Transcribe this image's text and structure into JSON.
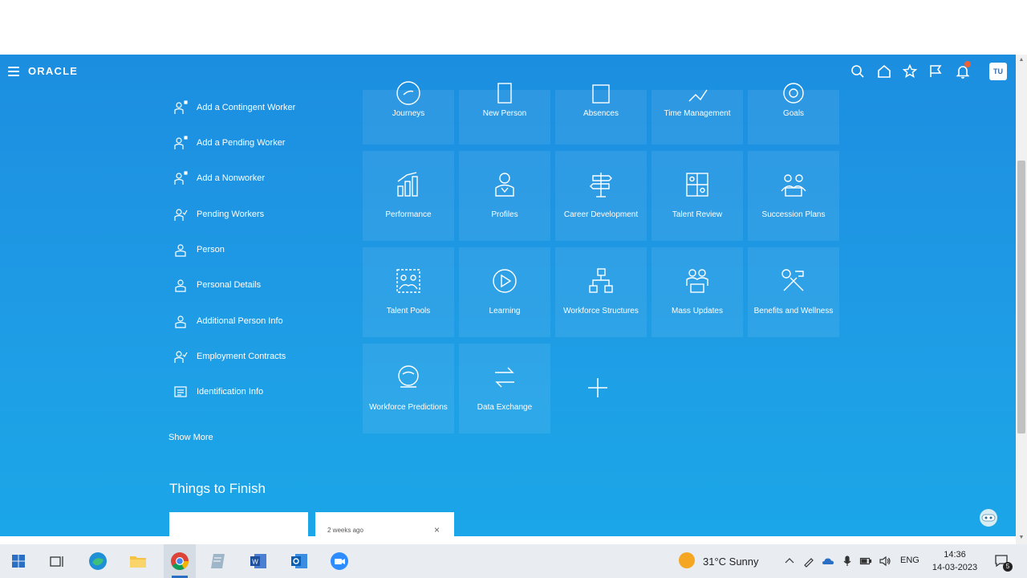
{
  "header": {
    "logo": "ORACLE",
    "avatar_initials": "TU"
  },
  "quick_actions": [
    {
      "label": "Add a Contingent Worker",
      "icon": "add-person-icon"
    },
    {
      "label": "Add a Pending Worker",
      "icon": "add-person-icon"
    },
    {
      "label": "Add a Nonworker",
      "icon": "add-person-icon"
    },
    {
      "label": "Pending Workers",
      "icon": "person-check-icon"
    },
    {
      "label": "Person",
      "icon": "person-icon"
    },
    {
      "label": "Personal Details",
      "icon": "person-icon"
    },
    {
      "label": "Additional Person Info",
      "icon": "person-icon"
    },
    {
      "label": "Employment Contracts",
      "icon": "person-check-icon"
    },
    {
      "label": "Identification Info",
      "icon": "id-card-icon"
    }
  ],
  "show_more": "Show More",
  "tiles": [
    {
      "label": "Journeys",
      "icon": "journey-icon"
    },
    {
      "label": "New Person",
      "icon": "new-person-icon"
    },
    {
      "label": "Absences",
      "icon": "calendar-icon"
    },
    {
      "label": "Time Management",
      "icon": "time-icon"
    },
    {
      "label": "Goals",
      "icon": "goal-icon"
    },
    {
      "label": "Performance",
      "icon": "bar-chart-icon"
    },
    {
      "label": "Profiles",
      "icon": "profile-icon"
    },
    {
      "label": "Career Development",
      "icon": "signpost-icon"
    },
    {
      "label": "Talent Review",
      "icon": "talent-review-icon"
    },
    {
      "label": "Succession Plans",
      "icon": "succession-icon"
    },
    {
      "label": "Talent Pools",
      "icon": "talent-pool-icon"
    },
    {
      "label": "Learning",
      "icon": "play-icon"
    },
    {
      "label": "Workforce Structures",
      "icon": "structure-icon"
    },
    {
      "label": "Mass Updates",
      "icon": "mass-update-icon"
    },
    {
      "label": "Benefits and Wellness",
      "icon": "tools-icon"
    },
    {
      "label": "Workforce Predictions",
      "icon": "crystal-ball-icon"
    },
    {
      "label": "Data Exchange",
      "icon": "exchange-icon"
    }
  ],
  "things_to_finish": {
    "title": "Things to Finish",
    "cards": [
      {
        "time": ""
      },
      {
        "time": "2 weeks ago",
        "close": "×"
      }
    ]
  },
  "taskbar": {
    "weather": "31°C  Sunny",
    "language": "ENG",
    "time": "14:36",
    "date": "14-03-2023",
    "notification_count": "5"
  }
}
